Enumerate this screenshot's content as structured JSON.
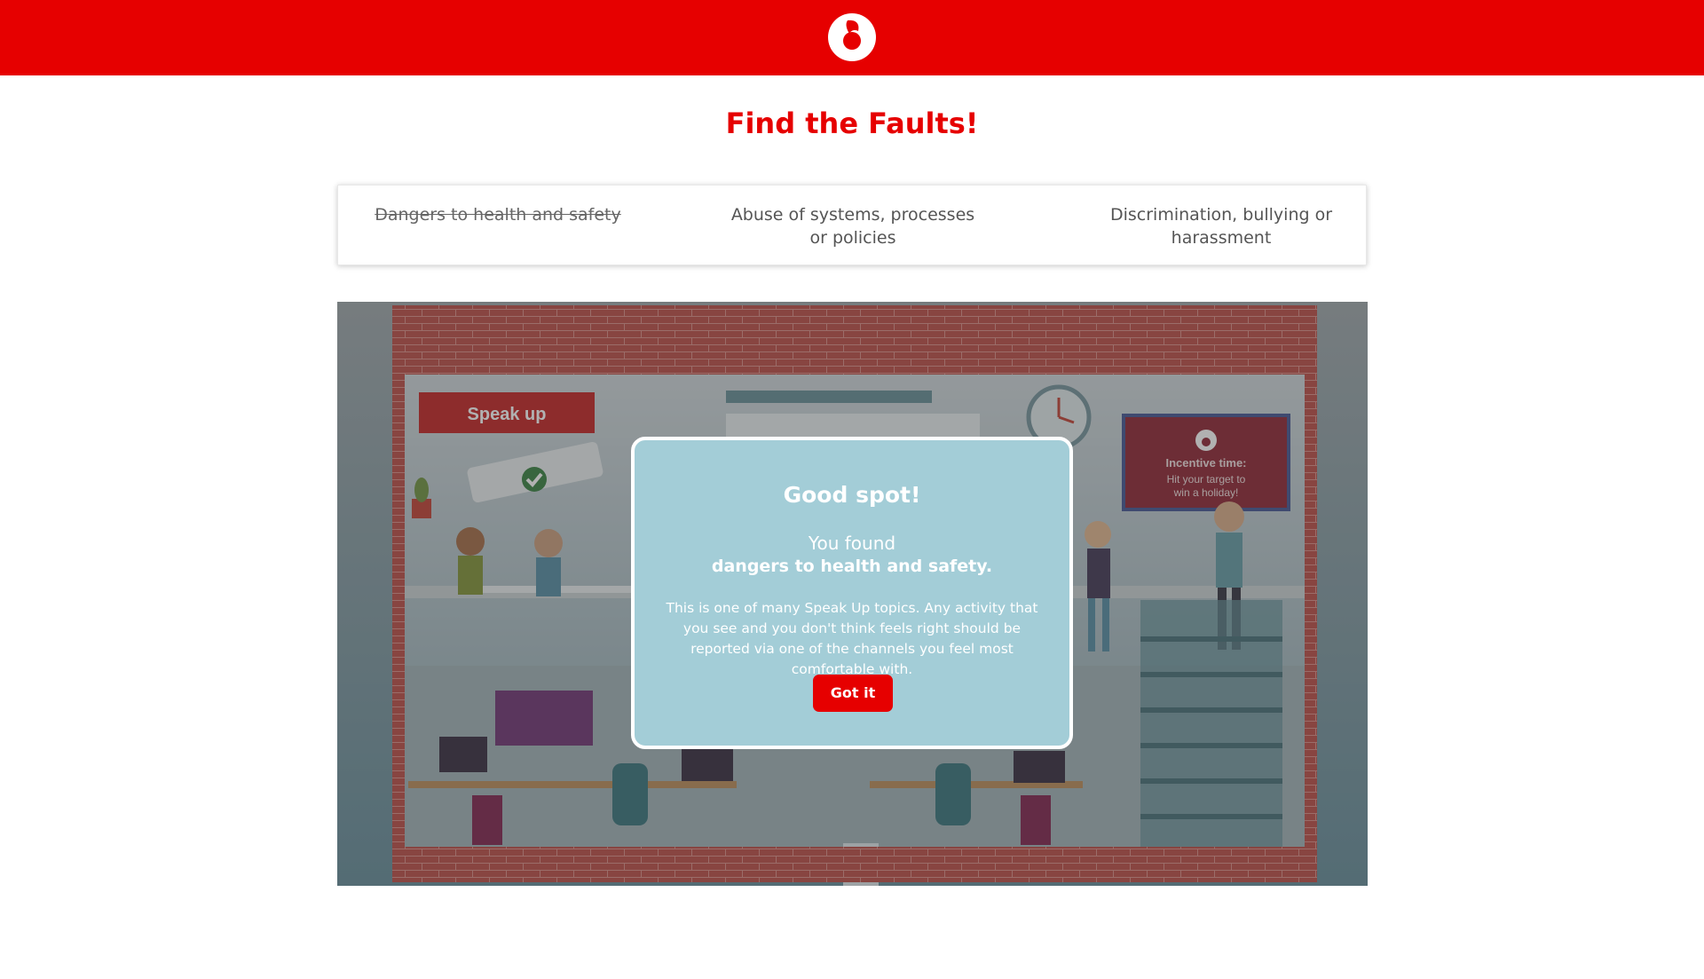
{
  "header": {
    "logo": "vodafone-speechmark-logo"
  },
  "page": {
    "title": "Find the Faults!"
  },
  "categories": [
    {
      "label": "Dangers to health and safety",
      "found": true
    },
    {
      "label": "Abuse of systems, processes or policies",
      "found": false
    },
    {
      "label": "Discrimination, bullying or harassment",
      "found": false
    }
  ],
  "scene": {
    "speak_up_sign": "Speak up",
    "screen_heading": "Incentive time:",
    "screen_text_line1": "Hit your target to",
    "screen_text_line2": "win a holiday!"
  },
  "modal": {
    "title": "Good spot!",
    "found_prefix": "You found",
    "topic": "dangers to health and safety.",
    "body": "This is one of many Speak Up topics. Any activity that you see and you don't think feels right should be reported via one of the channels you feel most comfortable with.",
    "button": "Got it"
  },
  "colors": {
    "brand_red": "#e60000",
    "modal_bg": "#a3cdd7"
  }
}
